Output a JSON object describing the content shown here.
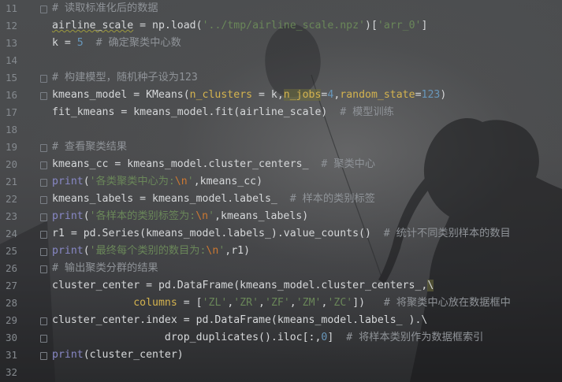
{
  "lines": [
    {
      "n": "11",
      "segments": [
        {
          "t": "# 读取标准化后的数据",
          "c": "c"
        }
      ]
    },
    {
      "n": "12",
      "segments": [
        {
          "t": "airline_scale",
          "c": "w"
        },
        {
          "t": " = np.load(",
          "c": ""
        },
        {
          "t": "'../tmp/airline_scale.npz'",
          "c": "s"
        },
        {
          "t": ")[",
          "c": ""
        },
        {
          "t": "'arr_0'",
          "c": "s"
        },
        {
          "t": "]",
          "c": ""
        }
      ]
    },
    {
      "n": "13",
      "segments": [
        {
          "t": "k = ",
          "c": ""
        },
        {
          "t": "5",
          "c": "n"
        },
        {
          "t": "  # 确定聚类中心数",
          "c": "c"
        }
      ]
    },
    {
      "n": "14",
      "segments": []
    },
    {
      "n": "15",
      "segments": [
        {
          "t": "# 构建模型，随机种子设为123",
          "c": "c"
        }
      ]
    },
    {
      "n": "16",
      "segments": [
        {
          "t": "kmeans_model = KMeans(",
          "c": ""
        },
        {
          "t": "n_clusters",
          "c": "p"
        },
        {
          "t": " = k,",
          "c": ""
        },
        {
          "t": "n_jobs",
          "c": "ph"
        },
        {
          "t": "=",
          "c": ""
        },
        {
          "t": "4",
          "c": "n"
        },
        {
          "t": ",",
          "c": ""
        },
        {
          "t": "random_state",
          "c": "p"
        },
        {
          "t": "=",
          "c": ""
        },
        {
          "t": "123",
          "c": "n"
        },
        {
          "t": ")",
          "c": ""
        }
      ]
    },
    {
      "n": "17",
      "segments": [
        {
          "t": "fit_kmeans = kmeans_model.fit(airline_scale)",
          "c": ""
        },
        {
          "t": "  # 模型训练",
          "c": "c"
        }
      ]
    },
    {
      "n": "18",
      "segments": []
    },
    {
      "n": "19",
      "segments": [
        {
          "t": "# 查看聚类结果",
          "c": "c"
        }
      ]
    },
    {
      "n": "20",
      "segments": [
        {
          "t": "kmeans_cc = kmeans_model.cluster_centers_",
          "c": ""
        },
        {
          "t": "  # 聚类中心",
          "c": "c"
        }
      ]
    },
    {
      "n": "21",
      "segments": [
        {
          "t": "print",
          "c": "b"
        },
        {
          "t": "(",
          "c": ""
        },
        {
          "t": "'各类聚类中心为:",
          "c": "s"
        },
        {
          "t": "\\n",
          "c": "e"
        },
        {
          "t": "'",
          "c": "s"
        },
        {
          "t": ",kmeans_cc)",
          "c": ""
        }
      ]
    },
    {
      "n": "22",
      "segments": [
        {
          "t": "kmeans_labels = kmeans_model.labels_",
          "c": ""
        },
        {
          "t": "  # 样本的类别标签",
          "c": "c"
        }
      ]
    },
    {
      "n": "23",
      "segments": [
        {
          "t": "print",
          "c": "b"
        },
        {
          "t": "(",
          "c": ""
        },
        {
          "t": "'各样本的类别标签为:",
          "c": "s"
        },
        {
          "t": "\\n",
          "c": "e"
        },
        {
          "t": "'",
          "c": "s"
        },
        {
          "t": ",kmeans_labels)",
          "c": ""
        }
      ]
    },
    {
      "n": "24",
      "segments": [
        {
          "t": "r1 = pd.Series(kmeans_model.labels_).value_counts()",
          "c": ""
        },
        {
          "t": "  # 统计不同类别样本的数目",
          "c": "c"
        }
      ]
    },
    {
      "n": "25",
      "segments": [
        {
          "t": "print",
          "c": "b"
        },
        {
          "t": "(",
          "c": ""
        },
        {
          "t": "'最终每个类别的数目为:",
          "c": "s"
        },
        {
          "t": "\\n",
          "c": "e"
        },
        {
          "t": "'",
          "c": "s"
        },
        {
          "t": ",r1)",
          "c": ""
        }
      ]
    },
    {
      "n": "26",
      "segments": [
        {
          "t": "# 输出聚类分群的结果",
          "c": "c"
        }
      ]
    },
    {
      "n": "27",
      "segments": [
        {
          "t": "cluster_center = pd.DataFrame(kmeans_model.cluster_centers_,",
          "c": ""
        },
        {
          "t": "\\",
          "c": "ch"
        }
      ]
    },
    {
      "n": "28",
      "segments": [
        {
          "t": "             ",
          "c": ""
        },
        {
          "t": "columns",
          "c": "p"
        },
        {
          "t": " = [",
          "c": ""
        },
        {
          "t": "'ZL'",
          "c": "s"
        },
        {
          "t": ",",
          "c": ""
        },
        {
          "t": "'ZR'",
          "c": "s"
        },
        {
          "t": ",",
          "c": ""
        },
        {
          "t": "'ZF'",
          "c": "s"
        },
        {
          "t": ",",
          "c": ""
        },
        {
          "t": "'ZM'",
          "c": "s"
        },
        {
          "t": ",",
          "c": ""
        },
        {
          "t": "'ZC'",
          "c": "s"
        },
        {
          "t": "])",
          "c": ""
        },
        {
          "t": "   # 将聚类中心放在数据框中",
          "c": "c"
        }
      ]
    },
    {
      "n": "29",
      "segments": [
        {
          "t": "cluster_center.index = pd.DataFrame(kmeans_model.labels_ ).\\",
          "c": ""
        }
      ]
    },
    {
      "n": "30",
      "segments": [
        {
          "t": "                  drop_duplicates().iloc[:,",
          "c": ""
        },
        {
          "t": "0",
          "c": "n"
        },
        {
          "t": "]",
          "c": ""
        },
        {
          "t": "  # 将样本类别作为数据框索引",
          "c": "c"
        }
      ]
    },
    {
      "n": "31",
      "segments": [
        {
          "t": "print",
          "c": "b"
        },
        {
          "t": "(cluster_center)",
          "c": ""
        }
      ]
    },
    {
      "n": "32",
      "segments": []
    }
  ],
  "fold_markers": [
    "11",
    "15",
    "16",
    "19",
    "20",
    "21",
    "22",
    "23",
    "24",
    "25",
    "26",
    "29",
    "30",
    "31"
  ]
}
